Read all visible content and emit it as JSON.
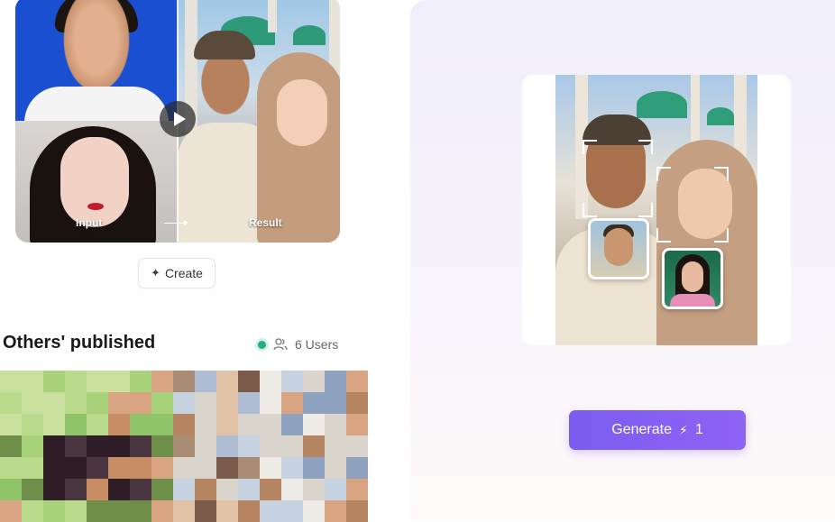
{
  "hero": {
    "input_label": "Input",
    "result_label": "Result"
  },
  "create_button": {
    "label": "Create"
  },
  "published": {
    "title": "Others' published",
    "users": "6 Users",
    "status_color": "#22b07d"
  },
  "generate": {
    "label": "Generate",
    "credits": "1",
    "accent": "#7b5cf0"
  }
}
